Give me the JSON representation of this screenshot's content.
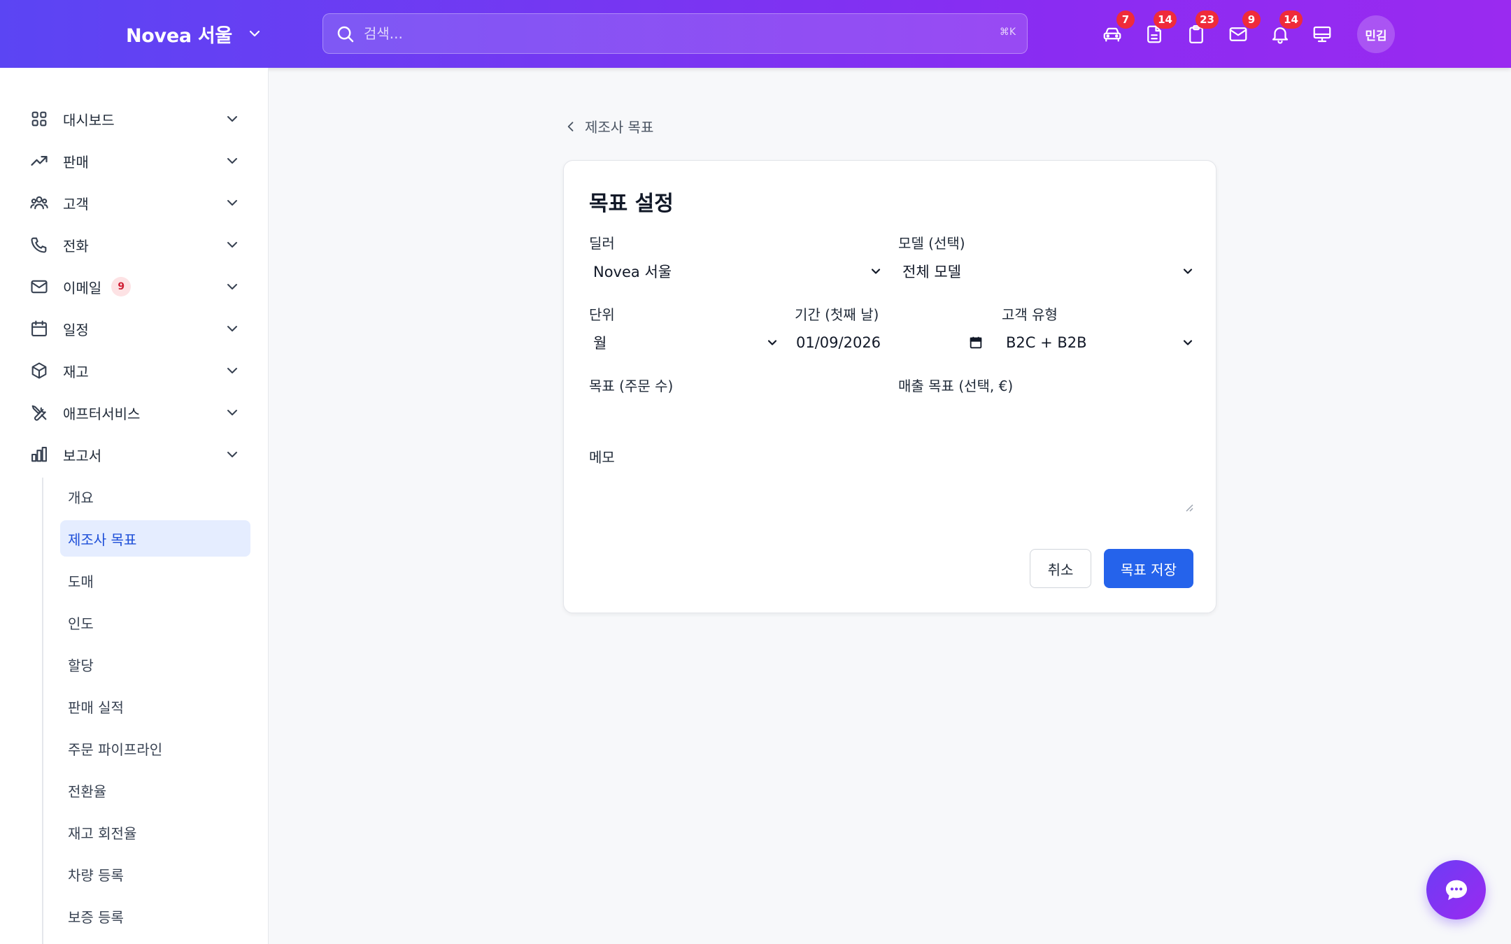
{
  "header": {
    "brand": "Novea 서울",
    "search_placeholder": "검색...",
    "search_shortcut": "⌘K",
    "icons": [
      {
        "name": "car-icon",
        "badge": "7"
      },
      {
        "name": "document-icon",
        "badge": "14"
      },
      {
        "name": "clipboard-icon",
        "badge": "23"
      },
      {
        "name": "mail-icon",
        "badge": "9"
      },
      {
        "name": "bell-icon",
        "badge": "14"
      },
      {
        "name": "monitor-icon",
        "badge": ""
      }
    ],
    "avatar_initials": "민김"
  },
  "sidebar": {
    "items": [
      {
        "label": "대시보드",
        "icon": "grid-icon"
      },
      {
        "label": "판매",
        "icon": "trending-up-icon"
      },
      {
        "label": "고객",
        "icon": "users-icon"
      },
      {
        "label": "전화",
        "icon": "phone-icon"
      },
      {
        "label": "이메일",
        "icon": "mail-icon",
        "badge": "9"
      },
      {
        "label": "일정",
        "icon": "calendar-icon"
      },
      {
        "label": "재고",
        "icon": "box-icon"
      },
      {
        "label": "애프터서비스",
        "icon": "tools-icon"
      },
      {
        "label": "보고서",
        "icon": "bar-chart-icon"
      }
    ],
    "report_subitems": [
      {
        "label": "개요"
      },
      {
        "label": "제조사 목표",
        "active": true
      },
      {
        "label": "도매"
      },
      {
        "label": "인도"
      },
      {
        "label": "할당"
      },
      {
        "label": "판매 실적"
      },
      {
        "label": "주문 파이프라인"
      },
      {
        "label": "전환율"
      },
      {
        "label": "재고 회전율"
      },
      {
        "label": "차량 등록"
      },
      {
        "label": "보증 등록"
      }
    ]
  },
  "breadcrumb": {
    "back_label": "제조사 목표"
  },
  "form": {
    "title": "목표 설정",
    "dealer_label": "딜러",
    "dealer_value": "Novea 서울",
    "model_label": "모델 (선택)",
    "model_value": "전체 모델",
    "unit_label": "단위",
    "unit_value": "월",
    "period_label": "기간 (첫째 날)",
    "period_value": "01/09/2026",
    "customer_type_label": "고객 유형",
    "customer_type_value": "B2C + B2B",
    "target_orders_label": "목표 (주문 수)",
    "target_orders_value": "",
    "revenue_target_label": "매출 목표 (선택, €)",
    "revenue_target_value": "",
    "memo_label": "메모",
    "memo_value": "",
    "cancel_label": "취소",
    "save_label": "목표 저장"
  },
  "colors": {
    "header_gradient_start": "#5b45f3",
    "header_gradient_end": "#9a2af0",
    "primary": "#2563eb",
    "active_bg": "#e5edff",
    "badge_red": "#ef2b3a"
  }
}
